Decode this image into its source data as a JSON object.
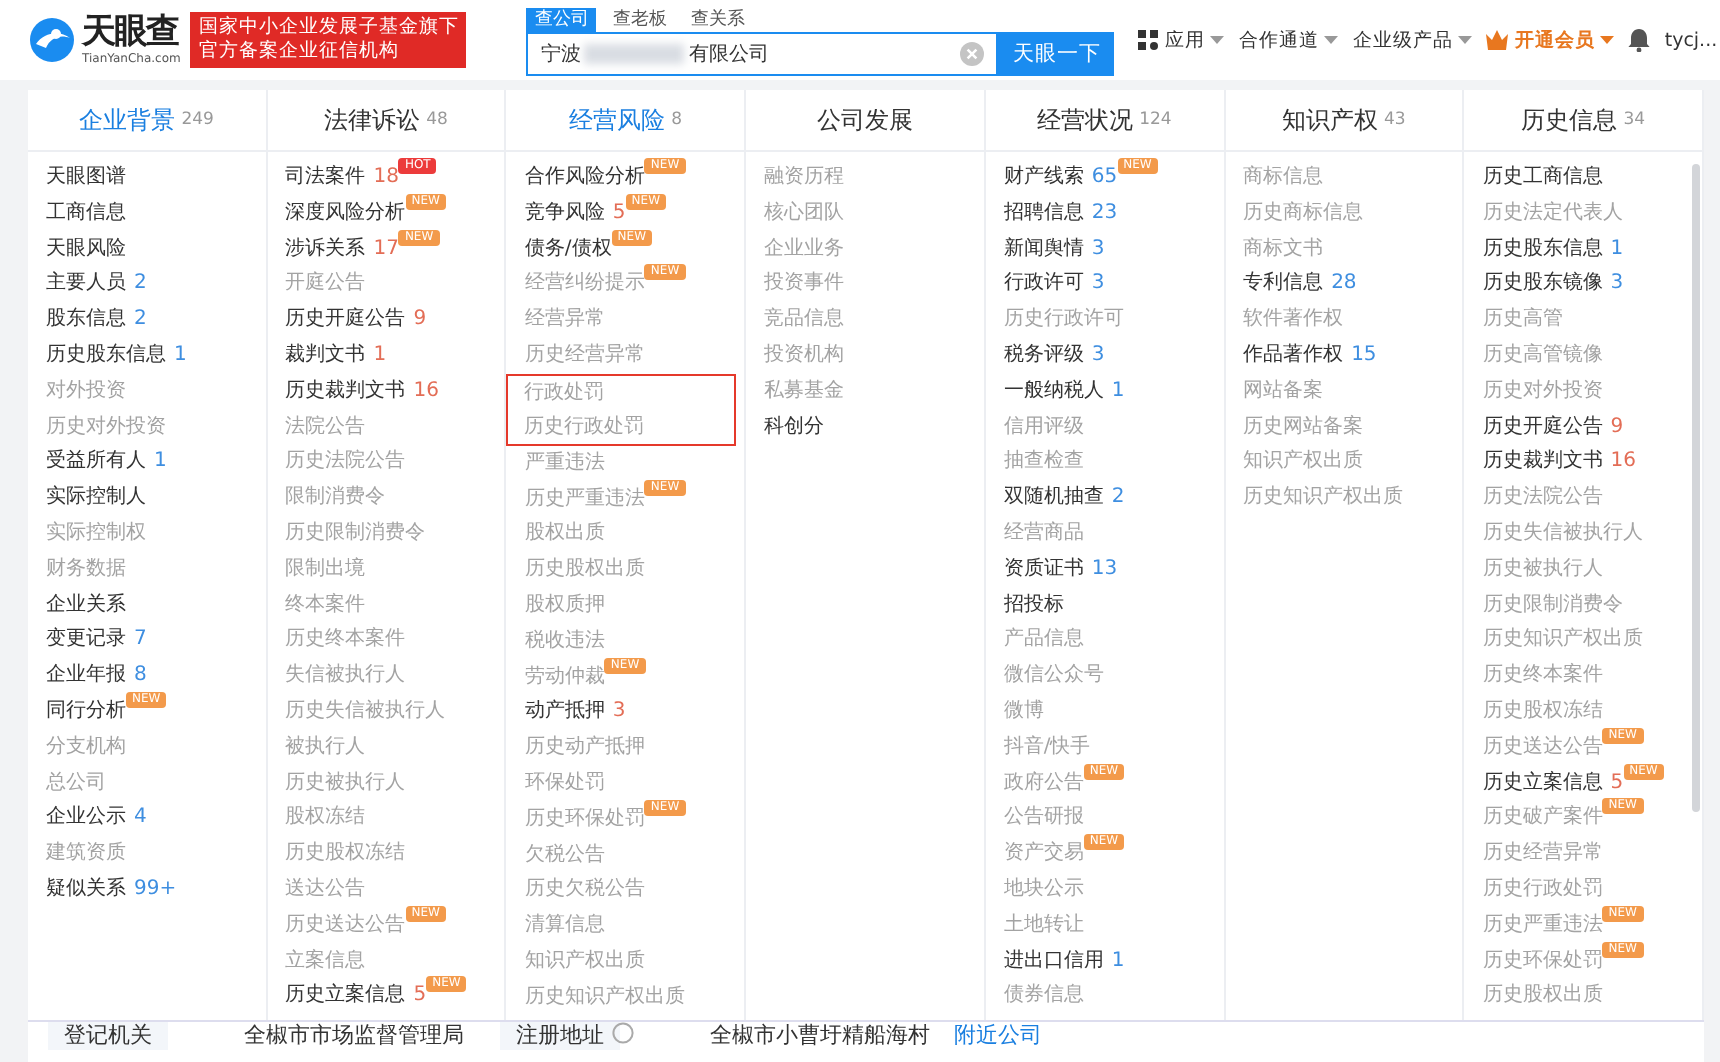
{
  "header": {
    "logo": {
      "name": "天眼查",
      "domain": "TianYanCha.com"
    },
    "badge_lines": [
      "国家中小企业发展子基金旗下",
      "官方备案企业征信机构"
    ],
    "search_tabs": [
      {
        "label": "查公司",
        "selected": true
      },
      {
        "label": "查老板",
        "selected": false
      },
      {
        "label": "查关系",
        "selected": false
      }
    ],
    "search": {
      "value_start": "宁波",
      "value_end": "有限公司",
      "redacted": true,
      "button": "天眼一下"
    },
    "nav": [
      {
        "label": "应用",
        "kind": "apps",
        "dropdown": true
      },
      {
        "label": "合作通道",
        "kind": "plain",
        "dropdown": true
      },
      {
        "label": "企业级产品",
        "kind": "plain",
        "dropdown": true
      },
      {
        "label": "开通会员",
        "kind": "vip",
        "dropdown": true
      },
      {
        "kind": "bell"
      },
      {
        "label": "tycj...",
        "kind": "user",
        "dropdown": false
      }
    ]
  },
  "columns": [
    {
      "title": "企业背景",
      "count": "249",
      "highlighted": true,
      "items": [
        {
          "text": "天眼图谱",
          "active": true
        },
        {
          "text": "工商信息",
          "active": true
        },
        {
          "text": "天眼风险",
          "active": true
        },
        {
          "text": "主要人员",
          "count": "2",
          "color": "#3e8ee0",
          "active": true
        },
        {
          "text": "股东信息",
          "count": "2",
          "color": "#3e8ee0",
          "active": true
        },
        {
          "text": "历史股东信息",
          "count": "1",
          "color": "#3e8ee0",
          "active": true
        },
        {
          "text": "对外投资",
          "active": false
        },
        {
          "text": "历史对外投资",
          "active": false
        },
        {
          "text": "受益所有人",
          "count": "1",
          "color": "#3e8ee0",
          "active": true
        },
        {
          "text": "实际控制人",
          "active": true
        },
        {
          "text": "实际控制权",
          "active": false
        },
        {
          "text": "财务数据",
          "active": false
        },
        {
          "text": "企业关系",
          "active": true
        },
        {
          "text": "变更记录",
          "count": "7",
          "color": "#3e8ee0",
          "active": true
        },
        {
          "text": "企业年报",
          "count": "8",
          "color": "#3e8ee0",
          "active": true
        },
        {
          "text": "同行分析",
          "active": true,
          "badge": {
            "text": "NEW",
            "kind": "new"
          }
        },
        {
          "text": "分支机构",
          "active": false
        },
        {
          "text": "总公司",
          "active": false
        },
        {
          "text": "企业公示",
          "count": "4",
          "color": "#3e8ee0",
          "active": true
        },
        {
          "text": "建筑资质",
          "active": false
        },
        {
          "text": "疑似关系",
          "count": "99+",
          "color": "#3e8ee0",
          "active": true
        }
      ]
    },
    {
      "title": "法律诉讼",
      "count": "48",
      "highlighted": false,
      "items": [
        {
          "text": "司法案件",
          "count": "18",
          "color": "#e36d56",
          "active": true,
          "badge": {
            "text": "HOT",
            "kind": "hot"
          }
        },
        {
          "text": "深度风险分析",
          "active": true,
          "badge": {
            "text": "NEW",
            "kind": "new"
          }
        },
        {
          "text": "涉诉关系",
          "count": "17",
          "color": "#e36d56",
          "active": true,
          "badge": {
            "text": "NEW",
            "kind": "new"
          }
        },
        {
          "text": "开庭公告",
          "active": false
        },
        {
          "text": "历史开庭公告",
          "count": "9",
          "color": "#e36d56",
          "active": true
        },
        {
          "text": "裁判文书",
          "count": "1",
          "color": "#e36d56",
          "active": true
        },
        {
          "text": "历史裁判文书",
          "count": "16",
          "color": "#e36d56",
          "active": true
        },
        {
          "text": "法院公告",
          "active": false
        },
        {
          "text": "历史法院公告",
          "active": false
        },
        {
          "text": "限制消费令",
          "active": false
        },
        {
          "text": "历史限制消费令",
          "active": false
        },
        {
          "text": "限制出境",
          "active": false
        },
        {
          "text": "终本案件",
          "active": false
        },
        {
          "text": "历史终本案件",
          "active": false
        },
        {
          "text": "失信被执行人",
          "active": false
        },
        {
          "text": "历史失信被执行人",
          "active": false
        },
        {
          "text": "被执行人",
          "active": false
        },
        {
          "text": "历史被执行人",
          "active": false
        },
        {
          "text": "股权冻结",
          "active": false
        },
        {
          "text": "历史股权冻结",
          "active": false
        },
        {
          "text": "送达公告",
          "active": false
        },
        {
          "text": "历史送达公告",
          "active": false,
          "badge": {
            "text": "NEW",
            "kind": "new"
          }
        },
        {
          "text": "立案信息",
          "active": false
        },
        {
          "text": "历史立案信息",
          "count": "5",
          "color": "#e36d56",
          "active": true,
          "badge": {
            "text": "NEW",
            "kind": "new"
          }
        }
      ]
    },
    {
      "title": "经营风险",
      "count": "8",
      "highlighted": true,
      "items": [
        {
          "text": "合作风险分析",
          "active": true,
          "badge": {
            "text": "NEW",
            "kind": "new"
          }
        },
        {
          "text": "竞争风险",
          "count": "5",
          "color": "#e36d56",
          "active": true,
          "badge": {
            "text": "NEW",
            "kind": "new"
          }
        },
        {
          "text": "债务/债权",
          "active": true,
          "badge": {
            "text": "NEW",
            "kind": "new"
          }
        },
        {
          "text": "经营纠纷提示",
          "active": false,
          "badge": {
            "text": "NEW",
            "kind": "new"
          }
        },
        {
          "text": "经营异常",
          "active": false
        },
        {
          "text": "历史经营异常",
          "active": false
        },
        {
          "text": "行政处罚",
          "active": false,
          "boxed": true
        },
        {
          "text": "历史行政处罚",
          "active": false,
          "boxed": true
        },
        {
          "text": "严重违法",
          "active": false
        },
        {
          "text": "历史严重违法",
          "active": false,
          "badge": {
            "text": "NEW",
            "kind": "new"
          }
        },
        {
          "text": "股权出质",
          "active": false
        },
        {
          "text": "历史股权出质",
          "active": false
        },
        {
          "text": "股权质押",
          "active": false
        },
        {
          "text": "税收违法",
          "active": false
        },
        {
          "text": "劳动仲裁",
          "active": false,
          "badge": {
            "text": "NEW",
            "kind": "new"
          }
        },
        {
          "text": "动产抵押",
          "count": "3",
          "color": "#e36d56",
          "active": true
        },
        {
          "text": "历史动产抵押",
          "active": false
        },
        {
          "text": "环保处罚",
          "active": false
        },
        {
          "text": "历史环保处罚",
          "active": false,
          "badge": {
            "text": "NEW",
            "kind": "new"
          }
        },
        {
          "text": "欠税公告",
          "active": false
        },
        {
          "text": "历史欠税公告",
          "active": false
        },
        {
          "text": "清算信息",
          "active": false
        },
        {
          "text": "知识产权出质",
          "active": false
        },
        {
          "text": "历史知识产权出质",
          "active": false
        }
      ]
    },
    {
      "title": "公司发展",
      "highlighted": false,
      "items": [
        {
          "text": "融资历程",
          "active": false
        },
        {
          "text": "核心团队",
          "active": false
        },
        {
          "text": "企业业务",
          "active": false
        },
        {
          "text": "投资事件",
          "active": false
        },
        {
          "text": "竞品信息",
          "active": false
        },
        {
          "text": "投资机构",
          "active": false
        },
        {
          "text": "私募基金",
          "active": false
        },
        {
          "text": "科创分",
          "active": true
        }
      ]
    },
    {
      "title": "经营状况",
      "count": "124",
      "highlighted": false,
      "items": [
        {
          "text": "财产线索",
          "count": "65",
          "color": "#3e8ee0",
          "active": true,
          "badge": {
            "text": "NEW",
            "kind": "new"
          }
        },
        {
          "text": "招聘信息",
          "count": "23",
          "color": "#3e8ee0",
          "active": true
        },
        {
          "text": "新闻舆情",
          "count": "3",
          "color": "#3e8ee0",
          "active": true
        },
        {
          "text": "行政许可",
          "count": "3",
          "color": "#3e8ee0",
          "active": true
        },
        {
          "text": "历史行政许可",
          "active": false
        },
        {
          "text": "税务评级",
          "count": "3",
          "color": "#3e8ee0",
          "active": true
        },
        {
          "text": "一般纳税人",
          "count": "1",
          "color": "#3e8ee0",
          "active": true
        },
        {
          "text": "信用评级",
          "active": false
        },
        {
          "text": "抽查检查",
          "active": false
        },
        {
          "text": "双随机抽查",
          "count": "2",
          "color": "#3e8ee0",
          "active": true
        },
        {
          "text": "经营商品",
          "active": false
        },
        {
          "text": "资质证书",
          "count": "13",
          "color": "#3e8ee0",
          "active": true
        },
        {
          "text": "招投标",
          "active": true
        },
        {
          "text": "产品信息",
          "active": false
        },
        {
          "text": "微信公众号",
          "active": false
        },
        {
          "text": "微博",
          "active": false
        },
        {
          "text": "抖音/快手",
          "active": false
        },
        {
          "text": "政府公告",
          "active": false,
          "badge": {
            "text": "NEW",
            "kind": "new"
          }
        },
        {
          "text": "公告研报",
          "active": false
        },
        {
          "text": "资产交易",
          "active": false,
          "badge": {
            "text": "NEW",
            "kind": "new"
          }
        },
        {
          "text": "地块公示",
          "active": false
        },
        {
          "text": "土地转让",
          "active": false
        },
        {
          "text": "进出口信用",
          "count": "1",
          "color": "#3e8ee0",
          "active": true
        },
        {
          "text": "债券信息",
          "active": false
        }
      ]
    },
    {
      "title": "知识产权",
      "count": "43",
      "highlighted": false,
      "items": [
        {
          "text": "商标信息",
          "active": false
        },
        {
          "text": "历史商标信息",
          "active": false
        },
        {
          "text": "商标文书",
          "active": false
        },
        {
          "text": "专利信息",
          "count": "28",
          "color": "#3e8ee0",
          "active": true
        },
        {
          "text": "软件著作权",
          "active": false
        },
        {
          "text": "作品著作权",
          "count": "15",
          "color": "#3e8ee0",
          "active": true
        },
        {
          "text": "网站备案",
          "active": false
        },
        {
          "text": "历史网站备案",
          "active": false
        },
        {
          "text": "知识产权出质",
          "active": false
        },
        {
          "text": "历史知识产权出质",
          "active": false
        }
      ]
    },
    {
      "title": "历史信息",
      "count": "34",
      "highlighted": false,
      "scrollbar": true,
      "items": [
        {
          "text": "历史工商信息",
          "active": true
        },
        {
          "text": "历史法定代表人",
          "active": false
        },
        {
          "text": "历史股东信息",
          "count": "1",
          "color": "#3e8ee0",
          "active": true
        },
        {
          "text": "历史股东镜像",
          "count": "3",
          "color": "#3e8ee0",
          "active": true
        },
        {
          "text": "历史高管",
          "active": false
        },
        {
          "text": "历史高管镜像",
          "active": false
        },
        {
          "text": "历史对外投资",
          "active": false
        },
        {
          "text": "历史开庭公告",
          "count": "9",
          "color": "#e36d56",
          "active": true
        },
        {
          "text": "历史裁判文书",
          "count": "16",
          "color": "#e36d56",
          "active": true
        },
        {
          "text": "历史法院公告",
          "active": false
        },
        {
          "text": "历史失信被执行人",
          "active": false
        },
        {
          "text": "历史被执行人",
          "active": false
        },
        {
          "text": "历史限制消费令",
          "active": false
        },
        {
          "text": "历史知识产权出质",
          "active": false
        },
        {
          "text": "历史终本案件",
          "active": false
        },
        {
          "text": "历史股权冻结",
          "active": false
        },
        {
          "text": "历史送达公告",
          "active": false,
          "badge": {
            "text": "NEW",
            "kind": "new"
          }
        },
        {
          "text": "历史立案信息",
          "count": "5",
          "color": "#e36d56",
          "active": true,
          "badge": {
            "text": "NEW",
            "kind": "new"
          }
        },
        {
          "text": "历史破产案件",
          "active": false,
          "badge": {
            "text": "NEW",
            "kind": "new"
          }
        },
        {
          "text": "历史经营异常",
          "active": false
        },
        {
          "text": "历史行政处罚",
          "active": false
        },
        {
          "text": "历史严重违法",
          "active": false,
          "badge": {
            "text": "NEW",
            "kind": "new"
          }
        },
        {
          "text": "历史环保处罚",
          "active": false,
          "badge": {
            "text": "NEW",
            "kind": "new"
          }
        },
        {
          "text": "历史股权出质",
          "active": false
        }
      ]
    }
  ],
  "footer_row": [
    {
      "text": "登记机关",
      "kind": "label"
    },
    {
      "text": "全椒市市场监督管理局",
      "kind": "value"
    },
    {
      "text": "注册地址",
      "kind": "label",
      "help": true
    },
    {
      "text": "全椒市小曹圩精船海村",
      "kind": "value"
    },
    {
      "text": "附近公司",
      "kind": "link"
    }
  ]
}
